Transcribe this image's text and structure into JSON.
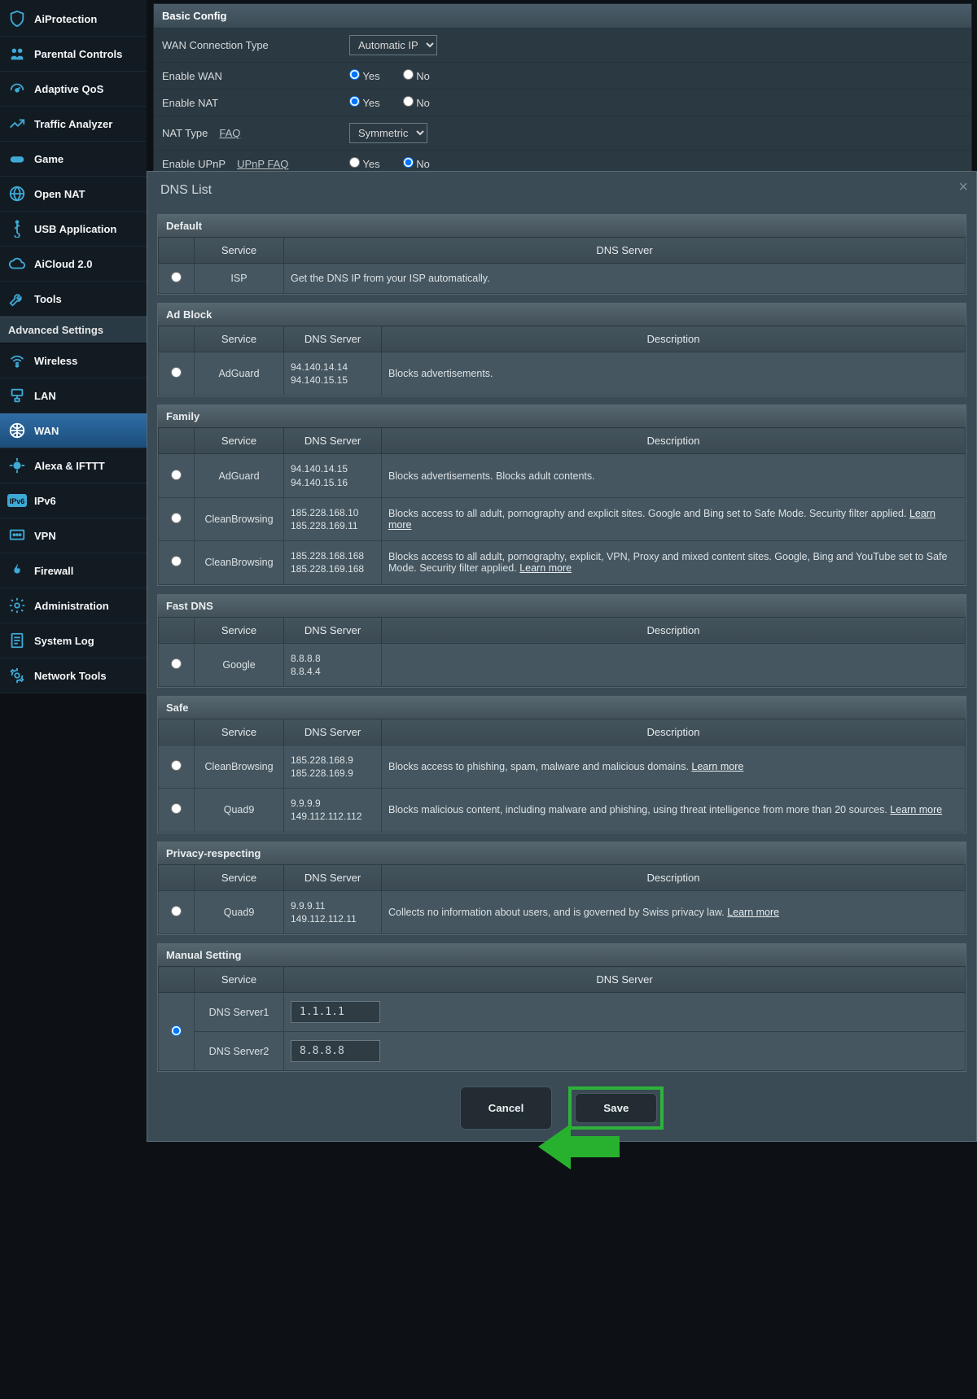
{
  "sidebar_top": [
    {
      "label": "AiProtection"
    },
    {
      "label": "Parental Controls"
    },
    {
      "label": "Adaptive QoS"
    },
    {
      "label": "Traffic Analyzer"
    },
    {
      "label": "Game"
    },
    {
      "label": "Open NAT"
    },
    {
      "label": "USB Application"
    },
    {
      "label": "AiCloud 2.0"
    },
    {
      "label": "Tools"
    }
  ],
  "adv_header": "Advanced Settings",
  "sidebar_adv": [
    {
      "label": "Wireless"
    },
    {
      "label": "LAN"
    },
    {
      "label": "WAN",
      "active": true
    },
    {
      "label": "Alexa & IFTTT"
    },
    {
      "label": "IPv6"
    },
    {
      "label": "VPN"
    },
    {
      "label": "Firewall"
    },
    {
      "label": "Administration"
    },
    {
      "label": "System Log"
    },
    {
      "label": "Network Tools"
    }
  ],
  "basic": {
    "title": "Basic Config",
    "wan_type_label": "WAN Connection Type",
    "wan_type_value": "Automatic IP",
    "enable_wan": "Enable WAN",
    "enable_nat": "Enable NAT",
    "nat_type": "NAT Type",
    "nat_type_value": "Symmetric",
    "enable_upnp": "Enable UPnP",
    "faq": "FAQ",
    "upnp_faq": "UPnP  FAQ",
    "yes": "Yes",
    "no": "No"
  },
  "modal": {
    "title": "DNS List",
    "headers": {
      "service": "Service",
      "dns": "DNS Server",
      "desc": "Description"
    },
    "sections": [
      {
        "name": "Default",
        "cols": [
          "radio",
          "service",
          "dns_wide"
        ],
        "rows": [
          {
            "service": "ISP",
            "dns_wide": "Get the DNS IP from your ISP automatically."
          }
        ]
      },
      {
        "name": "Ad Block",
        "cols": [
          "radio",
          "service",
          "dns",
          "desc"
        ],
        "rows": [
          {
            "service": "AdGuard",
            "dns": "94.140.14.14\n94.140.15.15",
            "desc": "Blocks advertisements."
          }
        ]
      },
      {
        "name": "Family",
        "cols": [
          "radio",
          "service",
          "dns",
          "desc"
        ],
        "rows": [
          {
            "service": "AdGuard",
            "dns": "94.140.14.15\n94.140.15.16",
            "desc": "Blocks advertisements. Blocks adult contents."
          },
          {
            "service": "CleanBrowsing",
            "dns": "185.228.168.10\n185.228.169.11",
            "desc": "Blocks access to all adult, pornography and explicit sites. Google and Bing set to Safe Mode. Security filter applied.",
            "learn": true
          },
          {
            "service": "CleanBrowsing",
            "dns": "185.228.168.168\n185.228.169.168",
            "desc": "Blocks access to all adult, pornography, explicit, VPN, Proxy and mixed content sites. Google, Bing and YouTube set to Safe Mode. Security filter applied.",
            "learn": true
          }
        ]
      },
      {
        "name": "Fast DNS",
        "cols": [
          "radio",
          "service",
          "dns",
          "desc"
        ],
        "rows": [
          {
            "service": "Google",
            "dns": "8.8.8.8\n8.8.4.4",
            "desc": ""
          }
        ]
      },
      {
        "name": "Safe",
        "cols": [
          "radio",
          "service",
          "dns",
          "desc"
        ],
        "rows": [
          {
            "service": "CleanBrowsing",
            "dns": "185.228.168.9\n185.228.169.9",
            "desc": "Blocks access to phishing, spam, malware and malicious domains.",
            "learn": true
          },
          {
            "service": "Quad9",
            "dns": "9.9.9.9\n149.112.112.112",
            "desc": "Blocks malicious content, including malware and phishing, using threat intelligence from more than 20 sources.",
            "learn": true
          }
        ]
      },
      {
        "name": "Privacy-respecting",
        "cols": [
          "radio",
          "service",
          "dns",
          "desc"
        ],
        "rows": [
          {
            "service": "Quad9",
            "dns": "9.9.9.11\n149.112.112.11",
            "desc": "Collects no information about users, and is governed by Swiss privacy law.",
            "learn": true
          }
        ]
      }
    ],
    "learn_label": "Learn more",
    "manual": {
      "title": "Manual Setting",
      "rows": [
        {
          "label": "DNS Server1",
          "value": "1.1.1.1"
        },
        {
          "label": "DNS Server2",
          "value": "8.8.8.8"
        }
      ]
    },
    "cancel": "Cancel",
    "save": "Save"
  }
}
